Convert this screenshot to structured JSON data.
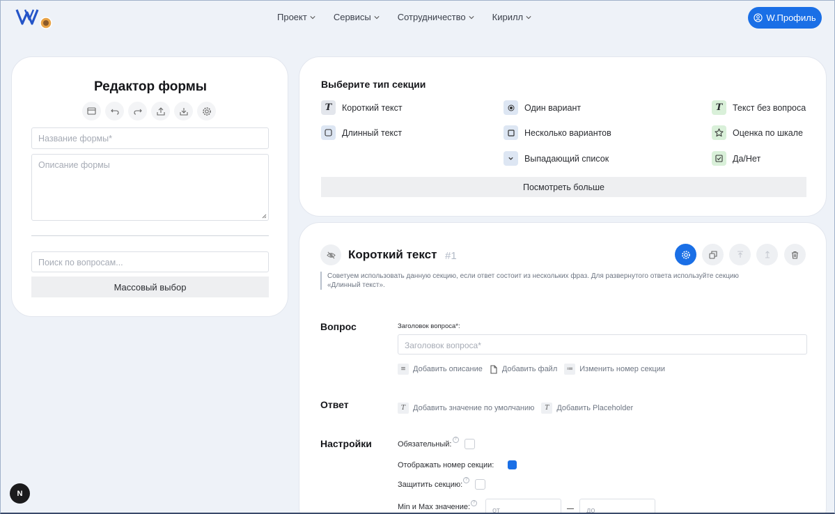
{
  "nav": {
    "items": [
      {
        "label": "Проект"
      },
      {
        "label": "Сервисы"
      },
      {
        "label": "Сотрудничество"
      },
      {
        "label": "Кирилл"
      }
    ],
    "profile_label": "W.Профиль"
  },
  "colors": {
    "accent": "#1a6fe6",
    "background": "#eef2f8",
    "text_icon_green": "#d9f0d9"
  },
  "left_panel": {
    "title": "Редактор формы",
    "toolbar_icons": [
      "card-icon",
      "undo-icon",
      "redo-icon",
      "export-icon",
      "import-icon",
      "gear-icon"
    ],
    "name_placeholder": "Название формы*",
    "description_placeholder": "Описание формы",
    "search_placeholder": "Поиск по вопросам...",
    "bulk_select_label": "Массовый выбор"
  },
  "section_types": {
    "title": "Выберите тип секции",
    "items": [
      {
        "label": "Короткий текст",
        "icon": "text-icon"
      },
      {
        "label": "Длинный текст",
        "icon": "textarea-icon"
      },
      {
        "label": "Один вариант",
        "icon": "radio-icon"
      },
      {
        "label": "Несколько вариантов",
        "icon": "checkbox-icon"
      },
      {
        "label": "Выпадающий список",
        "icon": "dropdown-icon"
      },
      {
        "label": "Текст без вопроса",
        "icon": "text-icon"
      },
      {
        "label": "Оценка по шкале",
        "icon": "star-icon"
      },
      {
        "label": "Да/Нет",
        "icon": "check-square-icon"
      }
    ],
    "more_label": "Посмотреть больше"
  },
  "editor": {
    "title": "Короткий текст",
    "number": "#1",
    "hint": "Советуем использовать данную секцию, если ответ состоит из нескольких фраз. Для развернутого ответа используйте секцию «Длинный текст».",
    "question_section": "Вопрос",
    "question_label": "Заголовок вопроса*:",
    "question_placeholder": "Заголовок вопроса*",
    "question_links": [
      "Добавить описание",
      "Добавить файл",
      "Изменить номер секции"
    ],
    "answer_section": "Ответ",
    "answer_links": [
      "Добавить значение по умолчанию",
      "Добавить Placeholder"
    ],
    "settings_section": "Настройки",
    "settings": {
      "required": "Обязательный:",
      "show_number": "Отображать номер секции:",
      "show_number_checked": true,
      "protect": "Защитить секцию:",
      "minmax": "Min и Max значение:",
      "min_placeholder": "от",
      "max_placeholder": "до"
    }
  },
  "badge": "N"
}
